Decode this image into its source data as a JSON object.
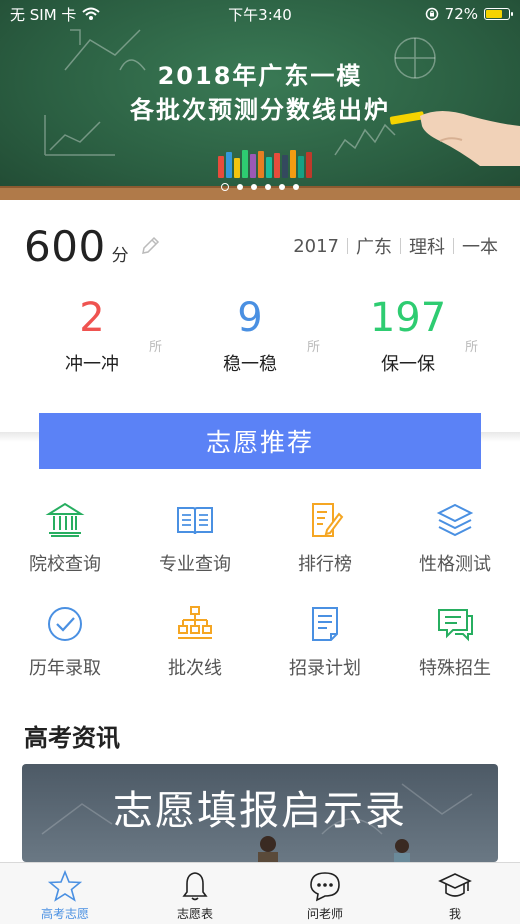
{
  "status_bar": {
    "carrier": "无 SIM 卡",
    "time": "下午3:40",
    "battery": "72%",
    "battery_level": 0.72
  },
  "banner": {
    "title": "2018年广东一模",
    "subtitle": "各批次预测分数线出炉",
    "page_count": 6,
    "active_page": 0
  },
  "score": {
    "value": "600",
    "unit": "分",
    "year": "2017",
    "province": "广东",
    "subject": "理科",
    "batch": "一本"
  },
  "stats": [
    {
      "number": "2",
      "unit": "所",
      "label": "冲一冲",
      "color": "#ef5350"
    },
    {
      "number": "9",
      "unit": "所",
      "label": "稳一稳",
      "color": "#4a90e2"
    },
    {
      "number": "197",
      "unit": "所",
      "label": "保一保",
      "color": "#2ecc71"
    }
  ],
  "recommend_button": "志愿推荐",
  "features": [
    {
      "label": "院校查询",
      "icon": "bank-icon",
      "color": "#27ae60"
    },
    {
      "label": "专业查询",
      "icon": "book-icon",
      "color": "#4a90e2"
    },
    {
      "label": "排行榜",
      "icon": "ranking-icon",
      "color": "#f5a623"
    },
    {
      "label": "性格测试",
      "icon": "layers-icon",
      "color": "#4a90e2"
    },
    {
      "label": "历年录取",
      "icon": "check-circle-icon",
      "color": "#4a90e2"
    },
    {
      "label": "批次线",
      "icon": "hierarchy-icon",
      "color": "#f5a623"
    },
    {
      "label": "招录计划",
      "icon": "document-icon",
      "color": "#4a90e2"
    },
    {
      "label": "特殊招生",
      "icon": "chat-icon",
      "color": "#27ae60"
    }
  ],
  "news": {
    "section_title": "高考资讯",
    "card_text": "志愿填报启示录"
  },
  "tabs": [
    {
      "label": "高考志愿",
      "icon": "star-icon",
      "active": true
    },
    {
      "label": "志愿表",
      "icon": "bell-icon",
      "active": false
    },
    {
      "label": "问老师",
      "icon": "message-icon",
      "active": false
    },
    {
      "label": "我",
      "icon": "graduation-cap-icon",
      "active": false
    }
  ]
}
